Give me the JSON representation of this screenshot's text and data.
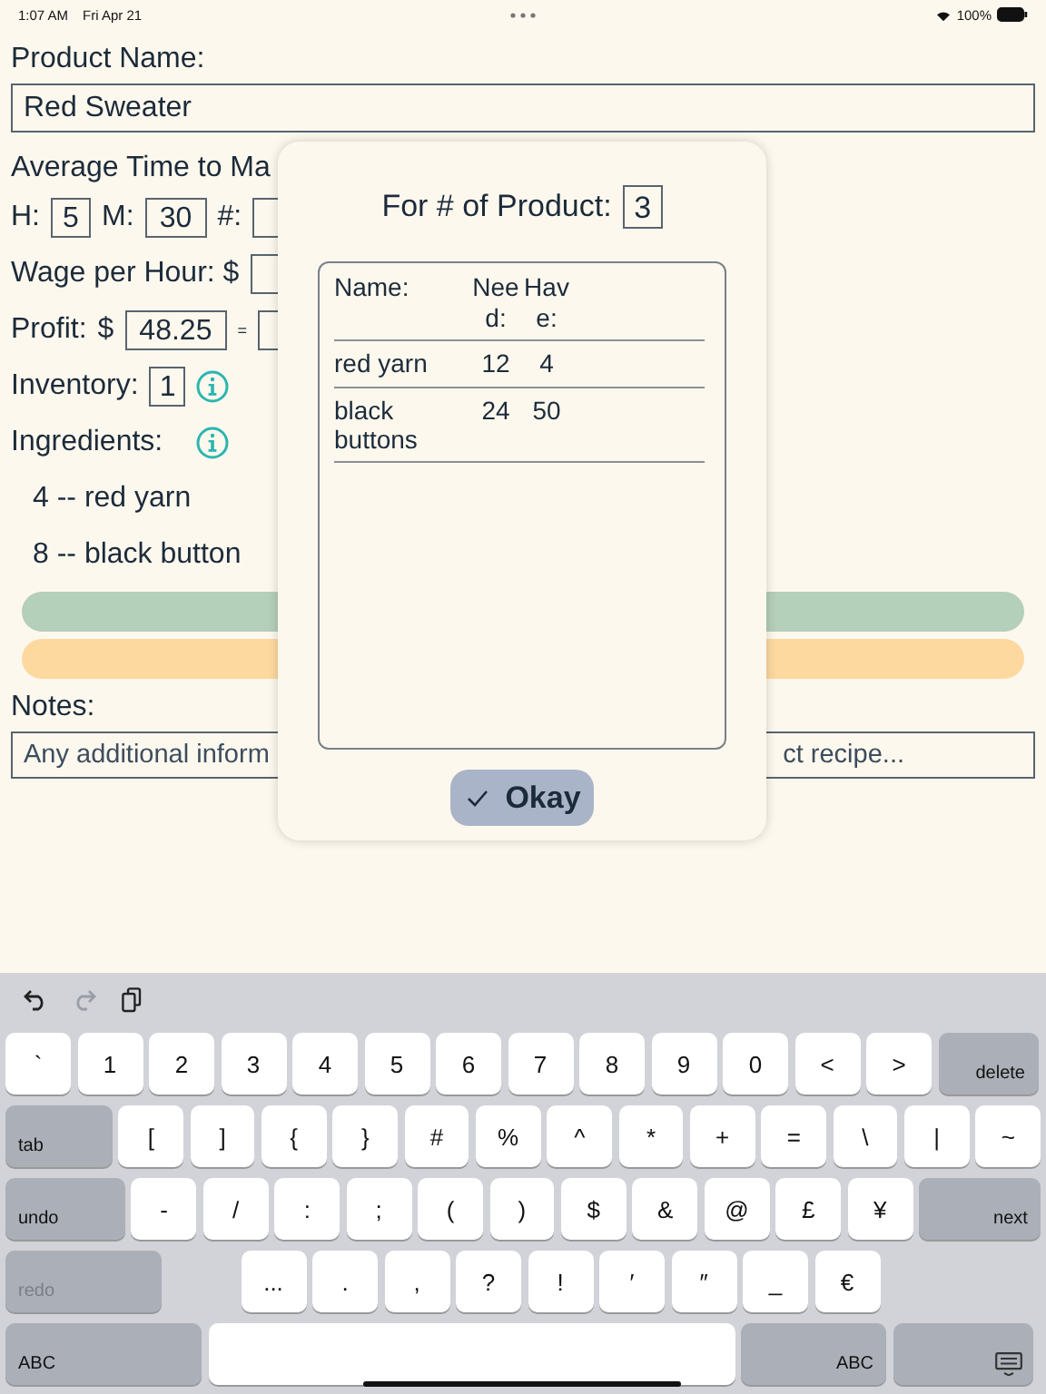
{
  "status_bar": {
    "time": "1:07 AM",
    "date": "Fri Apr 21",
    "battery": "100%"
  },
  "form": {
    "product_name_label": "Product Name:",
    "product_name": "Red Sweater",
    "time_label": "Average Time to Ma",
    "hours_label": "H:",
    "hours": "5",
    "minutes_label": "M:",
    "minutes": "30",
    "count_label": "#:",
    "wage_label": "Wage per Hour: $",
    "profit_label": "Profit:",
    "profit_currency": "$",
    "profit": "48.25",
    "equals": "=",
    "inventory_label": "Inventory:",
    "inventory": "1",
    "ingredients_label": "Ingredients:",
    "ingredients": [
      "4 -- red yarn",
      "8 -- black button"
    ],
    "notes_label": "Notes:",
    "notes_placeholder_parts": [
      "Any additional inform",
      "ct recipe..."
    ]
  },
  "popup": {
    "product_count_label": "For # of Product:",
    "product_count": "3",
    "columns": [
      "Name:",
      "Need:",
      "Have:"
    ],
    "rows": [
      [
        "red yarn",
        "12",
        "4"
      ],
      [
        "black buttons",
        "24",
        "50"
      ]
    ],
    "okay_button": "Okay"
  },
  "keyboard": {
    "toolbar": [
      {
        "kind": "undo",
        "disabled": false
      },
      {
        "kind": "redo",
        "disabled": true
      },
      {
        "kind": "paste",
        "disabled": false
      }
    ],
    "rows": [
      {
        "keys": [
          {
            "label": "`",
            "kind": "char",
            "disabled": false
          },
          {
            "label": "1",
            "kind": "char",
            "disabled": false
          },
          {
            "label": "2",
            "kind": "char",
            "disabled": false
          },
          {
            "label": "3",
            "kind": "char",
            "disabled": false
          },
          {
            "label": "4",
            "kind": "char",
            "disabled": false
          },
          {
            "label": "5",
            "kind": "char",
            "disabled": false
          },
          {
            "label": "6",
            "kind": "char",
            "disabled": false
          },
          {
            "label": "7",
            "kind": "char",
            "disabled": false
          },
          {
            "label": "8",
            "kind": "char",
            "disabled": false
          },
          {
            "label": "9",
            "kind": "char",
            "disabled": false
          },
          {
            "label": "0",
            "kind": "char",
            "disabled": false
          },
          {
            "label": "<",
            "kind": "char",
            "disabled": false
          },
          {
            "label": ">",
            "kind": "char",
            "disabled": false
          },
          {
            "label": "delete",
            "kind": "function",
            "disabled": false
          }
        ]
      },
      {
        "keys": [
          {
            "label": "tab",
            "kind": "function",
            "disabled": false
          },
          {
            "label": "[",
            "kind": "char",
            "disabled": false
          },
          {
            "label": "]",
            "kind": "char",
            "disabled": false
          },
          {
            "label": "{",
            "kind": "char",
            "disabled": false
          },
          {
            "label": "}",
            "kind": "char",
            "disabled": false
          },
          {
            "label": "#",
            "kind": "char",
            "disabled": false
          },
          {
            "label": "%",
            "kind": "char",
            "disabled": false
          },
          {
            "label": "^",
            "kind": "char",
            "disabled": false
          },
          {
            "label": "*",
            "kind": "char",
            "disabled": false
          },
          {
            "label": "+",
            "kind": "char",
            "disabled": false
          },
          {
            "label": "=",
            "kind": "char",
            "disabled": false
          },
          {
            "label": "\\",
            "kind": "char",
            "disabled": false
          },
          {
            "label": "|",
            "kind": "char",
            "disabled": false
          },
          {
            "label": "~",
            "kind": "char",
            "disabled": false
          }
        ]
      },
      {
        "keys": [
          {
            "label": "undo",
            "kind": "function",
            "disabled": false
          },
          {
            "label": "-",
            "kind": "char",
            "disabled": false
          },
          {
            "label": "/",
            "kind": "char",
            "disabled": false
          },
          {
            "label": ":",
            "kind": "char",
            "disabled": false
          },
          {
            "label": ";",
            "kind": "char",
            "disabled": false
          },
          {
            "label": "(",
            "kind": "char",
            "disabled": false
          },
          {
            "label": ")",
            "kind": "char",
            "disabled": false
          },
          {
            "label": "$",
            "kind": "char",
            "disabled": false
          },
          {
            "label": "&",
            "kind": "char",
            "disabled": false
          },
          {
            "label": "@",
            "kind": "char",
            "disabled": false
          },
          {
            "label": "£",
            "kind": "char",
            "disabled": false
          },
          {
            "label": "¥",
            "kind": "char",
            "disabled": false
          },
          {
            "label": "next",
            "kind": "function",
            "disabled": false
          }
        ]
      },
      {
        "keys": [
          {
            "label": "redo",
            "kind": "function",
            "disabled": true
          },
          {
            "label": "...",
            "kind": "char",
            "disabled": false
          },
          {
            "label": ".",
            "kind": "char",
            "disabled": false
          },
          {
            "label": ",",
            "kind": "char",
            "disabled": false
          },
          {
            "label": "?",
            "kind": "char",
            "disabled": false
          },
          {
            "label": "!",
            "kind": "char",
            "disabled": false
          },
          {
            "label": "′",
            "kind": "char",
            "disabled": false
          },
          {
            "label": "″",
            "kind": "char",
            "disabled": false
          },
          {
            "label": "_",
            "kind": "char",
            "disabled": false
          },
          {
            "label": "€",
            "kind": "char",
            "disabled": false
          }
        ]
      },
      {
        "keys": [
          {
            "label": "ABC",
            "kind": "function",
            "disabled": false
          },
          {
            "kind": "space",
            "disabled": false
          },
          {
            "label": "ABC",
            "kind": "function",
            "disabled": false
          },
          {
            "kind": "hide",
            "disabled": false
          }
        ]
      }
    ]
  }
}
